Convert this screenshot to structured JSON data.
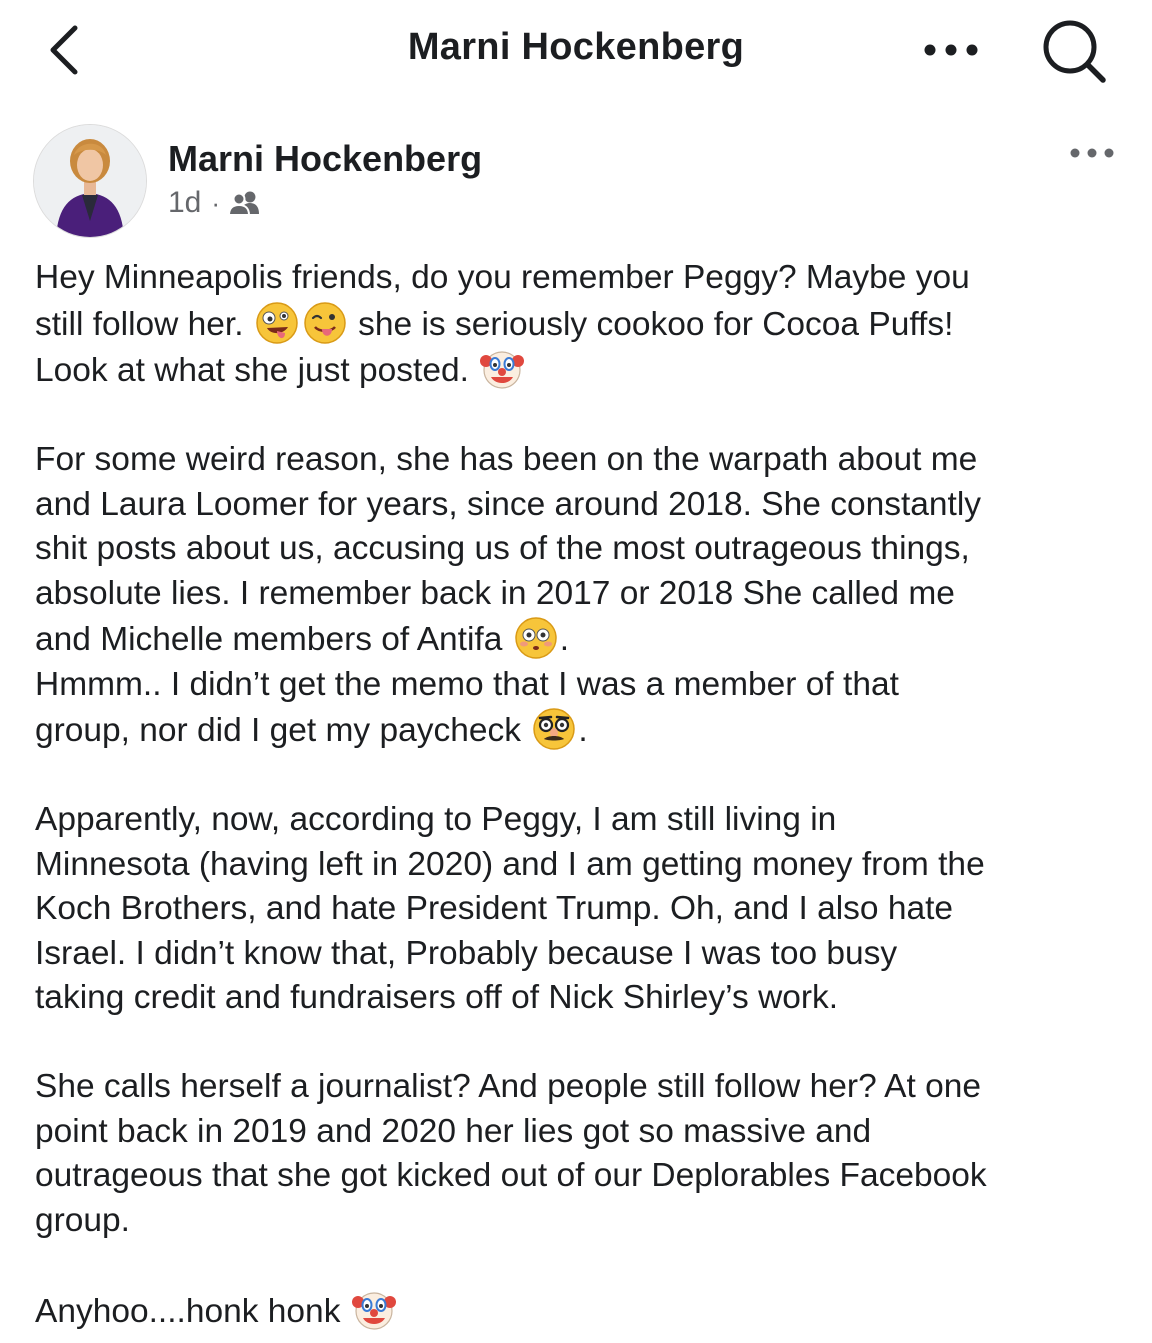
{
  "header": {
    "title": "Marni Hockenberg",
    "back_icon": "chevron-left-icon",
    "more_icon": "more-horizontal-icon",
    "search_icon": "search-icon"
  },
  "post": {
    "author": "Marni Hockenberg",
    "time": "1d",
    "separator": "·",
    "audience_icon": "friends-icon",
    "body": {
      "p1": {
        "l1": "Hey Minneapolis friends, do you remember Peggy? Maybe you",
        "l2a": "still follow her.",
        "l2b": "she is seriously cookoo for Cocoa Puffs!",
        "l3": "Look at what she just posted."
      },
      "p2": {
        "l1": "For some weird reason, she has been on the warpath about me",
        "l2": "and Laura Loomer for years, since around 2018. She constantly",
        "l3": "shit posts about us, accusing us of the most outrageous things,",
        "l4": "absolute lies. I remember back in 2017 or 2018 She called me",
        "l5a": "and Michelle members of Antifa",
        "l5b": ".",
        "l6": "Hmmm.. I didn’t get the memo that I was a member of that",
        "l7a": "group, nor did I get my paycheck",
        "l7b": "."
      },
      "p3": {
        "l1": "Apparently, now, according to Peggy, I am still living in",
        "l2": "Minnesota (having left in 2020) and I am getting money from the",
        "l3": "Koch Brothers, and hate President Trump. Oh, and I also hate",
        "l4": "Israel. I didn’t know that, Probably because I was too busy",
        "l5": "taking credit and fundraisers off of Nick Shirley’s work."
      },
      "p4": {
        "l1": "She calls herself a journalist? And people still follow her? At one",
        "l2": "point back in 2019 and 2020 her lies got so massive and",
        "l3": "outrageous that she got kicked out of our Deplorables Facebook",
        "l4": "group."
      },
      "p5": {
        "l1": "Anyhoo....honk honk"
      }
    },
    "emojis": [
      "zany-face-icon",
      "winking-tongue-face-icon",
      "clown-face-icon",
      "flushed-face-icon",
      "disguised-face-icon",
      "clown-face-icon"
    ]
  },
  "colors": {
    "text": "#1c1e21",
    "meta": "#65676b",
    "emoji_yellow": "#f7c53a"
  }
}
